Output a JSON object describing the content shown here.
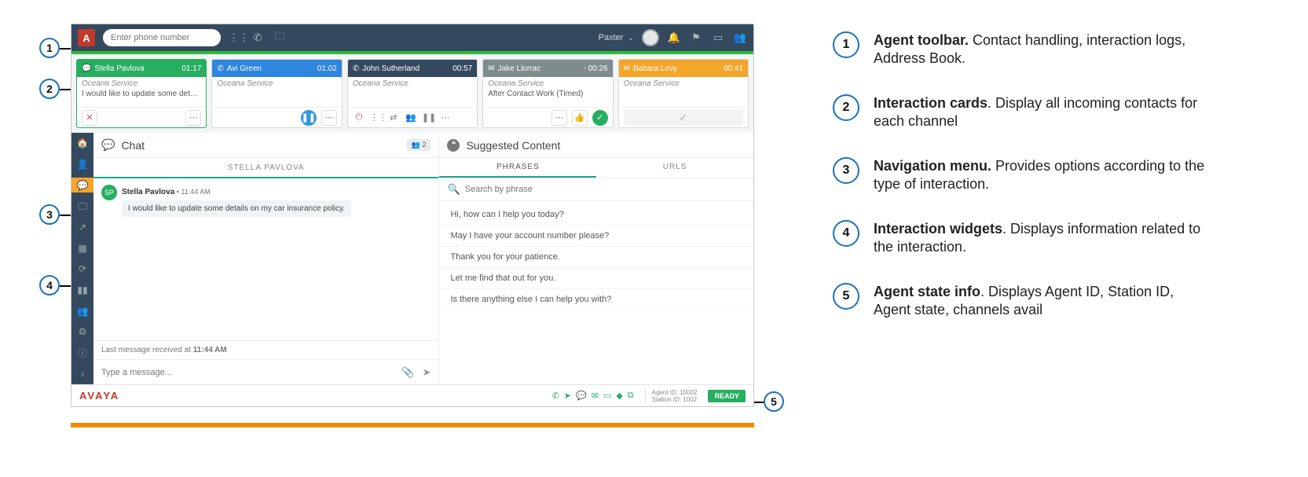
{
  "toolbar": {
    "phone_placeholder": "Enter phone number",
    "user_label": "Paxter"
  },
  "cards": [
    {
      "name": "Stella Pavlova",
      "time": "01:17",
      "service": "Oceana Service",
      "body": "I would like to update some details on m...",
      "color": "#27ae60",
      "icon": "chat"
    },
    {
      "name": "Avi Green",
      "time": "01:02",
      "service": "Oceana Service",
      "body": "",
      "color": "#2e86de",
      "icon": "phone"
    },
    {
      "name": "John Sutherland",
      "time": "00:57",
      "service": "Oceana Service",
      "body": "",
      "color": "#34495e",
      "icon": "phone"
    },
    {
      "name": "Jake Llorrac",
      "time": "- 00:26",
      "service": "Oceana Service",
      "body": "After Contact Work (Timed)",
      "color": "#7f8c8d",
      "icon": "mail"
    },
    {
      "name": "Babara Levy",
      "time": "00:41",
      "service": "Oceana Service",
      "body": "",
      "color": "#f4a62a",
      "icon": "mail"
    }
  ],
  "chat": {
    "title": "Chat",
    "participants": "2",
    "tab": "STELLA PAVLOVA",
    "msg_author": "Stella Pavlova",
    "msg_time": "11:44 AM",
    "msg_text": "I would like to update some details on my car insurance policy.",
    "last_received_prefix": "Last message received at ",
    "last_received_time": "11:44 AM",
    "compose_placeholder": "Type a message..."
  },
  "suggested": {
    "title": "Suggested Content",
    "tabs": [
      "PHRASES",
      "URLS"
    ],
    "search_placeholder": "Search by phrase",
    "phrases": [
      "Hi, how can I help you today?",
      "May I have your account number please?",
      "Thank you for your patience.",
      "Let me find that out for you.",
      "Is there anything else I can help you with?"
    ]
  },
  "footer": {
    "logo": "AVAYA",
    "agent_id": "Agent ID: 10002",
    "station_id": "Station ID: 1002",
    "state": "READY"
  },
  "legend": [
    {
      "b": "Agent toolbar.",
      "t": " Contact handling, interaction logs, Address Book."
    },
    {
      "b": "Interaction cards",
      "t": ". Display all incoming contacts for each channel"
    },
    {
      "b": "Navigation menu.",
      "t": " Provides options according to the type of interaction."
    },
    {
      "b": "Interaction widgets",
      "t": ". Displays information related to the interaction."
    },
    {
      "b": "Agent state info",
      "t": ". Displays Agent ID, Station ID, Agent state, channels avail"
    }
  ]
}
